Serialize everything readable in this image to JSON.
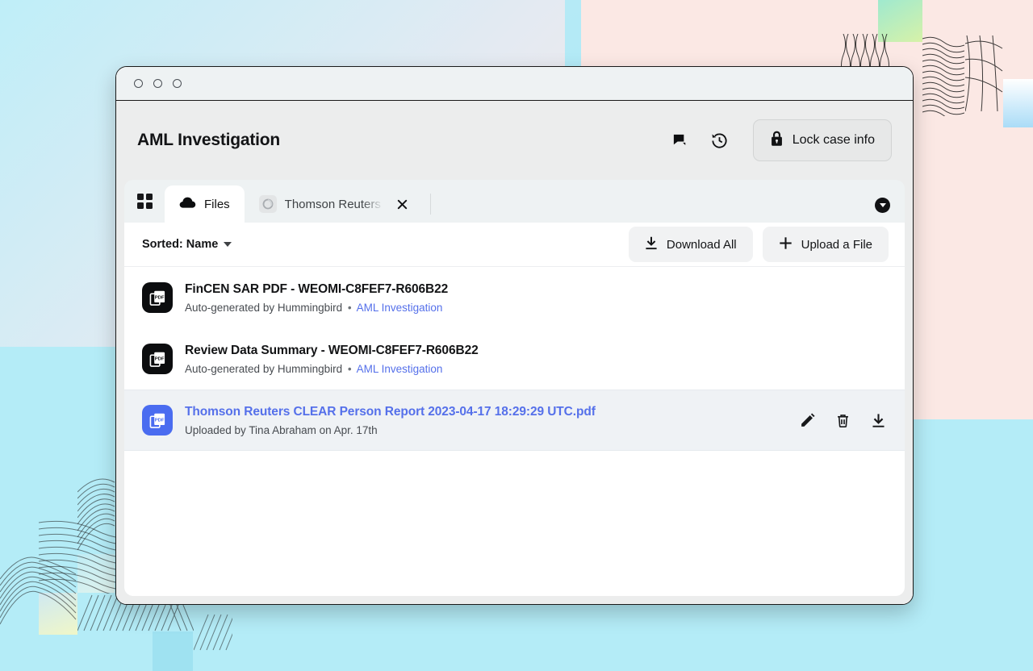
{
  "window": {
    "traffic_lights": [
      "close",
      "minimize",
      "maximize"
    ]
  },
  "header": {
    "case_title": "AML Investigation",
    "comment_icon": "chat-bubble-icon",
    "history_icon": "history-clock-icon",
    "lock_button": {
      "label": "Lock case info",
      "icon": "lock-icon"
    }
  },
  "tabs": {
    "grid_icon": "grid-apps-icon",
    "items": [
      {
        "label": "Files",
        "icon": "cloud-icon",
        "active": true,
        "closable": false
      },
      {
        "label": "Thomson Reuters CLEAR",
        "icon": "thomson-reuters-swirl-icon",
        "active": false,
        "closable": true
      }
    ],
    "overflow_icon": "chevron-down-circle-icon"
  },
  "toolbar": {
    "sort_label": "Sorted: Name",
    "download_all_label": "Download All",
    "download_all_icon": "download-icon",
    "upload_label": "Upload a File",
    "upload_icon": "plus-icon"
  },
  "files": [
    {
      "name": "FinCEN SAR PDF - WEOMI-C8FEF7-R606B22",
      "meta_prefix": "Auto-generated by Hummingbird",
      "meta_separator": "•",
      "meta_link": "AML Investigation",
      "icon": "pdf-file-icon",
      "icon_color": "#0c0d0f",
      "highlighted": false,
      "name_is_link": false
    },
    {
      "name": "Review Data Summary - WEOMI-C8FEF7-R606B22",
      "meta_prefix": "Auto-generated by Hummingbird",
      "meta_separator": "•",
      "meta_link": "AML Investigation",
      "icon": "pdf-file-icon",
      "icon_color": "#0c0d0f",
      "highlighted": false,
      "name_is_link": false
    },
    {
      "name": "Thomson Reuters CLEAR Person Report 2023-04-17 18:29:29 UTC.pdf",
      "meta_prefix": "Uploaded by Tina Abraham on Apr. 17th",
      "meta_separator": "",
      "meta_link": "",
      "icon": "pdf-file-icon",
      "icon_color": "#4a6cf0",
      "highlighted": true,
      "name_is_link": true,
      "actions": [
        "edit-icon",
        "delete-icon",
        "download-icon"
      ]
    }
  ],
  "colors": {
    "accent_blue": "#5570ea",
    "icon_blue": "#4a6cf0",
    "row_highlight": "#eff2f5",
    "window_chrome": "#eef2f3",
    "app_bg": "#eceded"
  }
}
